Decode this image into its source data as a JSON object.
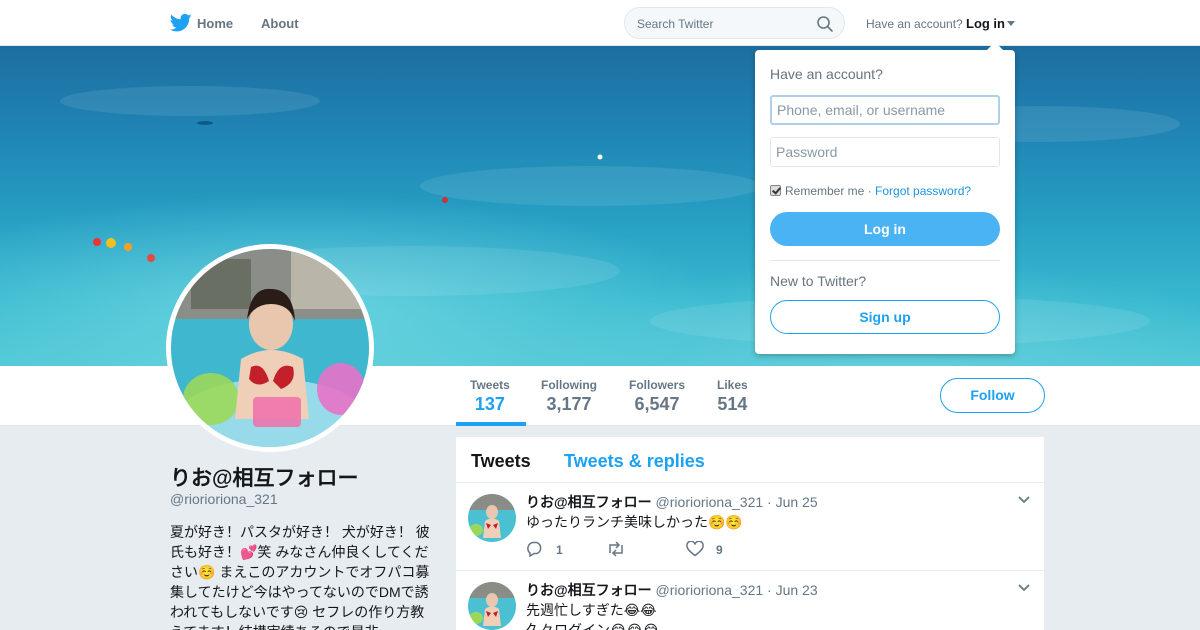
{
  "topbar": {
    "home_label": "Home",
    "about_label": "About",
    "search_placeholder": "Search Twitter",
    "have_account": "Have an account?",
    "login_label": "Log in"
  },
  "profile": {
    "name": "りお@相互フォロー",
    "handle": "@riorioriona_321",
    "bio": "夏が好き！パスタが好き！ 犬が好き！ 彼氏も好き！💕笑 みなさん仲良くしてください☺️ まえこのアカウントでオフパコ募集してたけど今はやってないのでDMで誘われてもしないです😢 セフレの作り方教えてます！結構実績あるので是非"
  },
  "stats": [
    {
      "label": "Tweets",
      "value": "137"
    },
    {
      "label": "Following",
      "value": "3,177"
    },
    {
      "label": "Followers",
      "value": "6,547"
    },
    {
      "label": "Likes",
      "value": "514"
    }
  ],
  "follow_label": "Follow",
  "timeline": {
    "tab_tweets": "Tweets",
    "tab_replies": "Tweets & replies",
    "tweets": [
      {
        "name": "りお@相互フォロー",
        "handle": "@riorioriona_321",
        "date": "· Jun 25",
        "text": "ゆったりランチ美味しかった☺️☺️",
        "replies": "1",
        "retweets": "",
        "likes": "9"
      },
      {
        "name": "りお@相互フォロー",
        "handle": "@riorioriona_321",
        "date": "· Jun 23",
        "text": "先週忙しすぎた😂😂",
        "text2": "久々ログイン😂😂😂",
        "replies": "",
        "retweets": "",
        "likes": ""
      }
    ]
  },
  "dropdown": {
    "title": "Have an account?",
    "username_placeholder": "Phone, email, or username",
    "password_placeholder": "Password",
    "remember_label": "Remember me",
    "separator": " · ",
    "forgot_label": "Forgot password?",
    "login_button": "Log in",
    "new_label": "New to Twitter?",
    "signup_button": "Sign up"
  },
  "colors": {
    "accent": "#1da1f2",
    "login_button": "#4ab3f4",
    "background": "#e6ecf0"
  }
}
